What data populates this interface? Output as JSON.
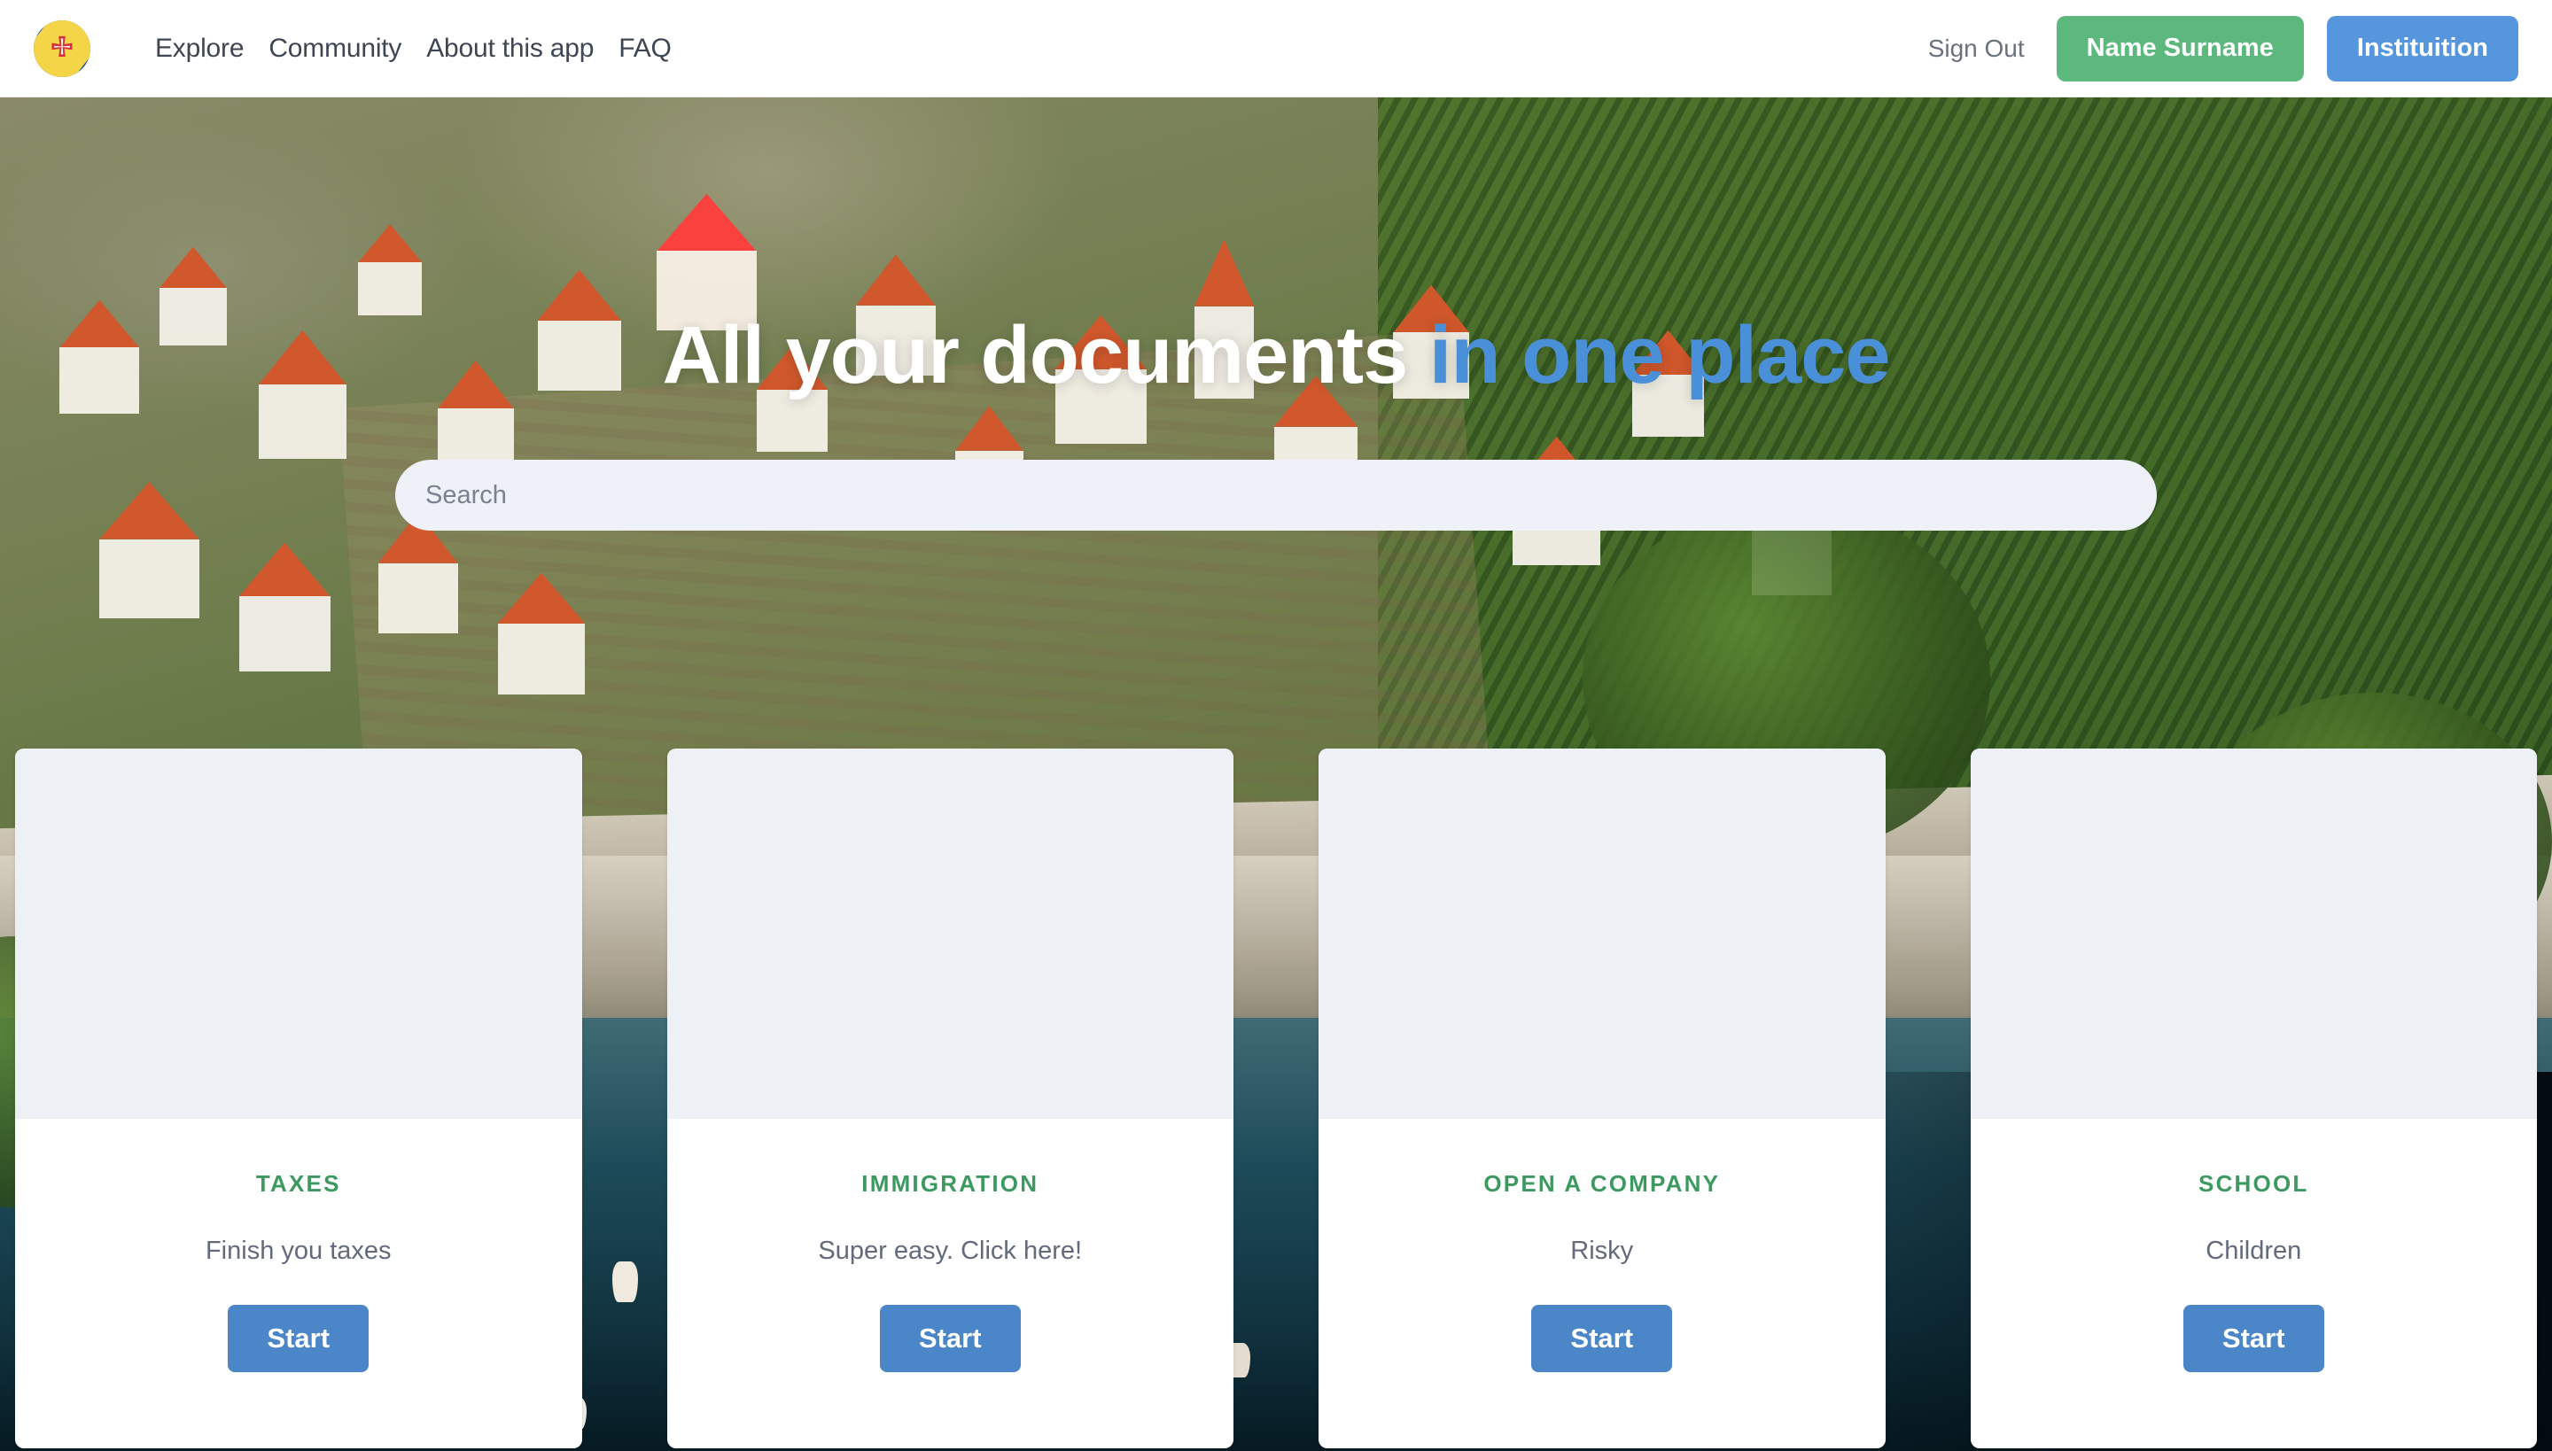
{
  "nav": {
    "logo_icon": "madeira-flag-logo",
    "links": [
      {
        "label": "Explore"
      },
      {
        "label": "Community"
      },
      {
        "label": "About this app"
      },
      {
        "label": "FAQ"
      }
    ],
    "sign_out_label": "Sign Out",
    "user_button_label": "Name Surname",
    "institution_button_label": "Instituition"
  },
  "hero": {
    "headline_white": "All your documents",
    "headline_blue": " in one place",
    "search_placeholder": "Search",
    "search_value": ""
  },
  "cards": [
    {
      "title": "TAXES",
      "desc": "Finish you taxes",
      "button": "Start"
    },
    {
      "title": "IMMIGRATION",
      "desc": "Super easy. Click here!",
      "button": "Start"
    },
    {
      "title": "OPEN A COMPANY",
      "desc": "Risky",
      "button": "Start"
    },
    {
      "title": "SCHOOL",
      "desc": "Children",
      "button": "Start"
    }
  ],
  "colors": {
    "accent_blue": "#4a90d9",
    "button_blue": "#4a86c8",
    "title_green": "#3c9960",
    "user_green": "#5cb87c",
    "institution_blue": "#5596dc",
    "card_media_gray": "#edf1f5",
    "search_bg": "#eef1f7",
    "nav_text": "#3e4654"
  }
}
